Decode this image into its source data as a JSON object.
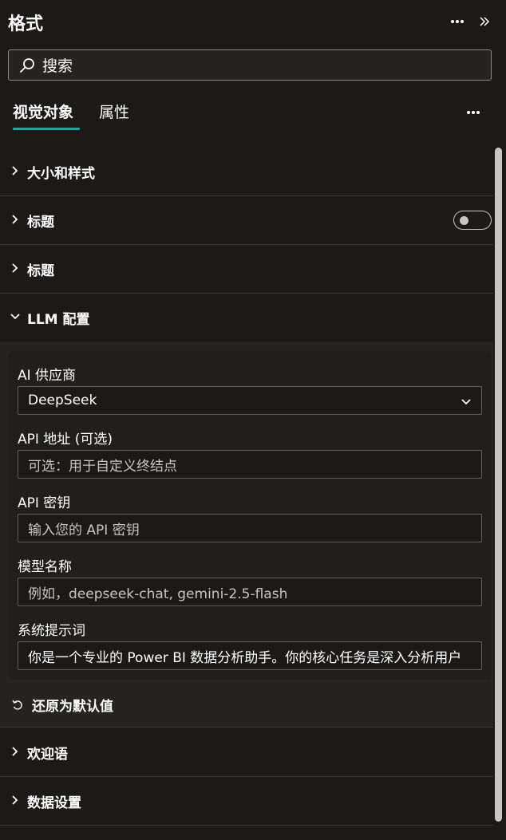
{
  "header": {
    "title": "格式"
  },
  "search": {
    "placeholder": "搜索"
  },
  "tabs": [
    {
      "label": "视觉对象",
      "active": true
    },
    {
      "label": "属性",
      "active": false
    }
  ],
  "sections": {
    "size_style": "大小和样式",
    "title_toggle": "标题",
    "title": "标题",
    "llm_config": "LLM 配置",
    "welcome": "欢迎语",
    "data_settings": "数据设置"
  },
  "llm": {
    "provider_label": "AI 供应商",
    "provider_value": "DeepSeek",
    "api_url_label": "API 地址 (可选)",
    "api_url_placeholder": "可选：用于自定义终结点",
    "api_key_label": "API 密钥",
    "api_key_placeholder": "输入您的 API 密钥",
    "model_label": "模型名称",
    "model_placeholder": "例如，deepseek-chat, gemini-2.5-flash",
    "system_prompt_label": "系统提示词",
    "system_prompt_value": "你是一个专业的 Power BI 数据分析助手。你的核心任务是深入分析用户",
    "reset_label": "还原为默认值"
  },
  "toggle": {
    "title_on": false
  },
  "colors": {
    "background": "#1b1a19",
    "accent": "#26a69a",
    "border": "#3b3a39"
  }
}
